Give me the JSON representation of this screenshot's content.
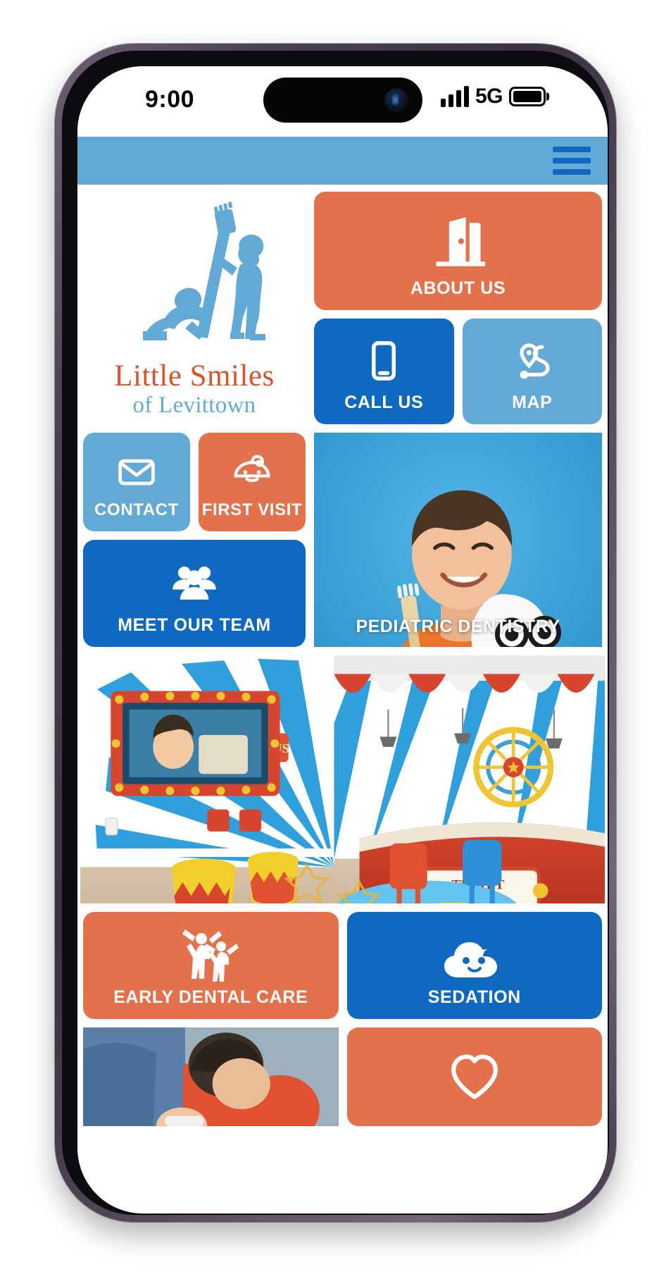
{
  "device": {
    "status_bar": {
      "time": "9:00",
      "network": "5G",
      "signal_icon": "signal-bars-icon",
      "battery_icon": "battery-full-icon",
      "camera_icon": "dynamic-island-camera"
    }
  },
  "app": {
    "header": {
      "menu_icon": "hamburger-menu-icon",
      "background_color": "#63a9d5",
      "menu_color": "#1069c0"
    },
    "brand": {
      "logo_icon": "children-toothbrush-logo",
      "title": "Little Smiles",
      "subtitle": "of Levittown",
      "title_color": "#d9542a",
      "subtitle_color": "#63a9d5"
    },
    "colors": {
      "orange": "#e3714c",
      "blue": "#1069c0",
      "light_blue": "#63a9d5",
      "white": "#ffffff"
    },
    "tiles": [
      {
        "id": "about-us",
        "label": "ABOUT US",
        "icon": "open-door-icon",
        "color": "#e3714c",
        "type": "icon"
      },
      {
        "id": "call-us",
        "label": "CALL US",
        "icon": "mobile-phone-icon",
        "color": "#1069c0",
        "type": "icon"
      },
      {
        "id": "map",
        "label": "MAP",
        "icon": "map-route-pin-icon",
        "color": "#63a9d5",
        "type": "icon"
      },
      {
        "id": "contact",
        "label": "CONTACT",
        "icon": "envelope-icon",
        "color": "#63a9d5",
        "type": "icon"
      },
      {
        "id": "first-visit",
        "label": "FIRST VISIT",
        "icon": "baby-face-icon",
        "color": "#e3714c",
        "type": "icon"
      },
      {
        "id": "meet-our-team",
        "label": "MEET OUR TEAM",
        "icon": "people-group-icon",
        "color": "#1069c0",
        "type": "icon"
      },
      {
        "id": "pediatric-dentistry",
        "label": "PEDIATRIC DENTISTRY",
        "icon": "photo-boy-with-plush-tooth",
        "type": "photo"
      },
      {
        "id": "office-tour",
        "label": "",
        "icon": "photo-circus-themed-office",
        "type": "photo"
      },
      {
        "id": "early-dental-care",
        "label": "EARLY DENTAL CARE",
        "icon": "jumping-children-icon",
        "color": "#e3714c",
        "type": "icon"
      },
      {
        "id": "sedation",
        "label": "SEDATION",
        "icon": "sleeping-cloud-icon",
        "color": "#1069c0",
        "type": "icon"
      },
      {
        "id": "patient-photo",
        "label": "",
        "icon": "photo-child-in-dental-chair",
        "type": "photo"
      },
      {
        "id": "favorites",
        "label": "",
        "icon": "heart-icon",
        "color": "#e3714c",
        "type": "icon"
      }
    ]
  }
}
